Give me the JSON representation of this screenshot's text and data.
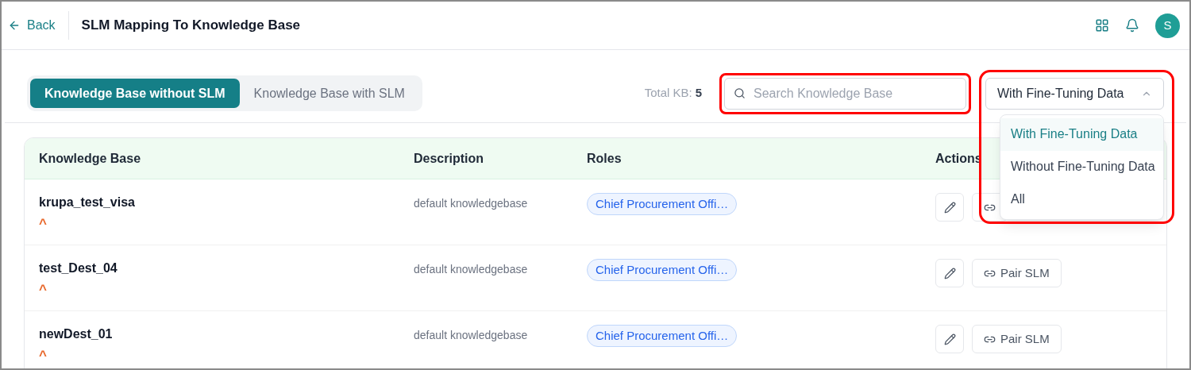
{
  "header": {
    "back_label": "Back",
    "title": "SLM Mapping To Knowledge Base",
    "avatar_letter": "S"
  },
  "tabs": [
    {
      "label": "Knowledge Base without SLM",
      "selected": true
    },
    {
      "label": "Knowledge Base with SLM",
      "selected": false
    }
  ],
  "total": {
    "label": "Total KB:",
    "value": "5"
  },
  "search": {
    "placeholder": "Search Knowledge Base",
    "highlighted": true
  },
  "filter": {
    "value": "With Fine-Tuning Data",
    "expanded": true,
    "highlighted": true,
    "options": [
      {
        "label": "With Fine-Tuning Data",
        "selected": true
      },
      {
        "label": "Without Fine-Tuning Data",
        "selected": false
      },
      {
        "label": "All",
        "selected": false
      }
    ]
  },
  "table": {
    "columns": [
      "Knowledge Base",
      "Description",
      "Roles",
      "Actions"
    ],
    "rows": [
      {
        "name": "krupa_test_visa",
        "marker": "^",
        "description": "default knowledgebase",
        "role": "Chief Procurement Offi…"
      },
      {
        "name": "test_Dest_04",
        "marker": "^",
        "description": "default knowledgebase",
        "role": "Chief Procurement Offi…",
        "pair_label": "Pair SLM"
      },
      {
        "name": "newDest_01",
        "marker": "^",
        "description": "default knowledgebase",
        "role": "Chief Procurement Offi…",
        "pair_label": "Pair SLM"
      }
    ]
  }
}
